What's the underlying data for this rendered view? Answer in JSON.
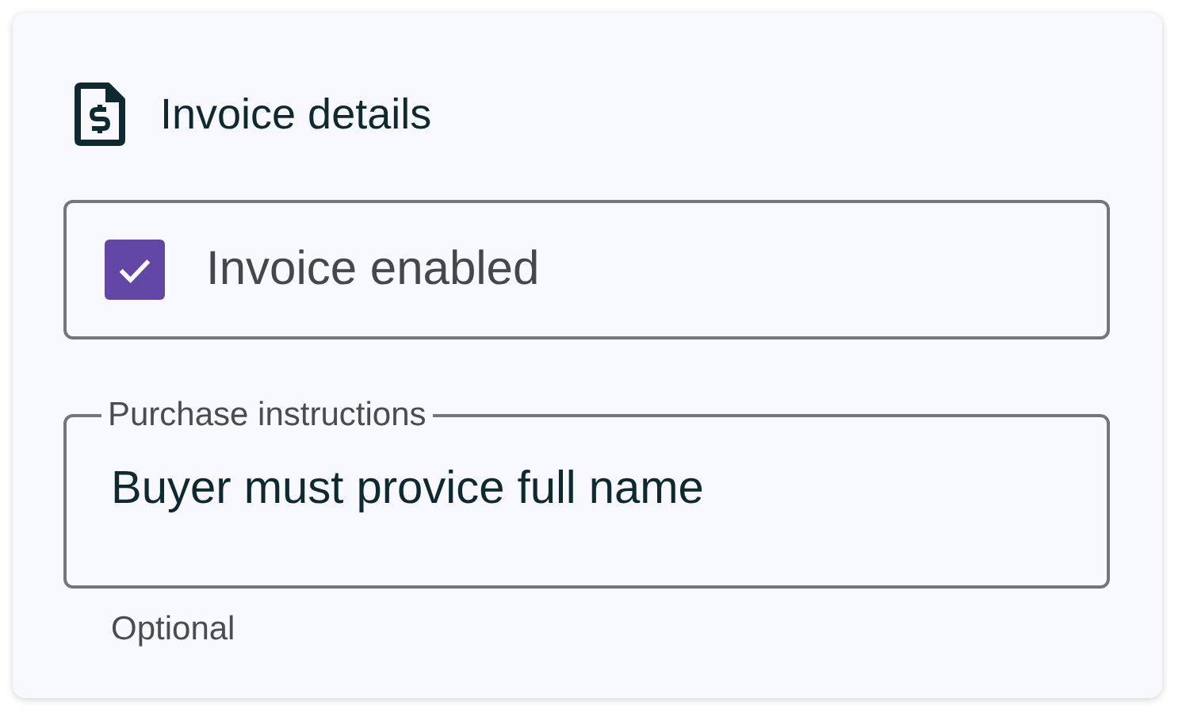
{
  "card": {
    "title": "Invoice details"
  },
  "invoice_checkbox": {
    "label": "Invoice enabled",
    "checked": true
  },
  "purchase_instructions": {
    "label": "Purchase instructions",
    "value": "Buyer must provice full name",
    "helper_text": "Optional"
  }
}
